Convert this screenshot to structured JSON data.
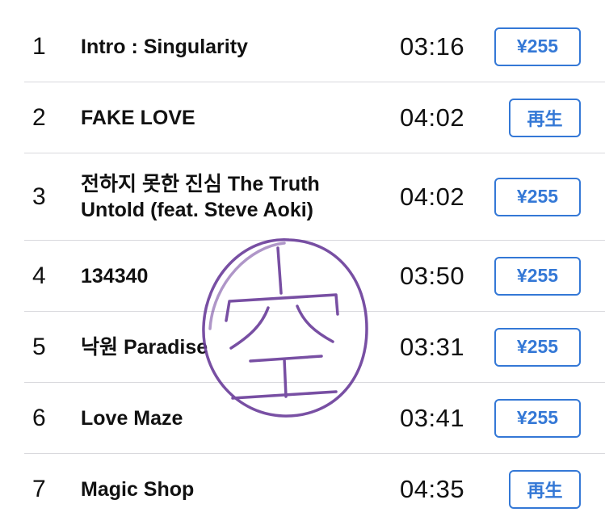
{
  "tracks": [
    {
      "number": "1",
      "title": "Intro : Singularity",
      "duration": "03:16",
      "action": "¥255",
      "action_type": "price"
    },
    {
      "number": "2",
      "title": "FAKE LOVE",
      "duration": "04:02",
      "action": "再生",
      "action_type": "play"
    },
    {
      "number": "3",
      "title": "전하지 못한 진심 The Truth Untold (feat. Steve Aoki)",
      "duration": "04:02",
      "action": "¥255",
      "action_type": "price"
    },
    {
      "number": "4",
      "title": "134340",
      "duration": "03:50",
      "action": "¥255",
      "action_type": "price"
    },
    {
      "number": "5",
      "title": "낙원 Paradise",
      "duration": "03:31",
      "action": "¥255",
      "action_type": "price"
    },
    {
      "number": "6",
      "title": "Love Maze",
      "duration": "03:41",
      "action": "¥255",
      "action_type": "price"
    },
    {
      "number": "7",
      "title": "Magic Shop",
      "duration": "04:35",
      "action": "再生",
      "action_type": "play"
    }
  ],
  "stamp": {
    "character": "空",
    "color": "#6a3d9a"
  },
  "colors": {
    "accent": "#3478d6",
    "divider": "#d9d9dd",
    "text": "#111111"
  }
}
